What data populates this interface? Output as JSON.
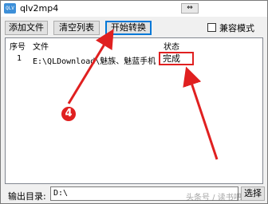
{
  "window": {
    "title": "qlv2mp4",
    "app_icon": "QLV"
  },
  "toolbar": {
    "add_files": "添加文件",
    "clear_list": "清空列表",
    "start_convert": "开始转换",
    "swap_icon": "⇔",
    "compat_mode": "兼容模式",
    "compat_checked": false
  },
  "list": {
    "headers": {
      "index": "序号",
      "file": "文件",
      "status": "状态"
    },
    "rows": [
      {
        "index": "1",
        "file": "E:\\QLDownload\\魅族、魅蓝手机...",
        "status": "完成"
      }
    ]
  },
  "output": {
    "label": "输出目录:",
    "path": "D:\\",
    "browse": "选择"
  },
  "annotation": {
    "step_number": "4",
    "color": "#e02020"
  },
  "watermark": "头条号 / 读书吧"
}
